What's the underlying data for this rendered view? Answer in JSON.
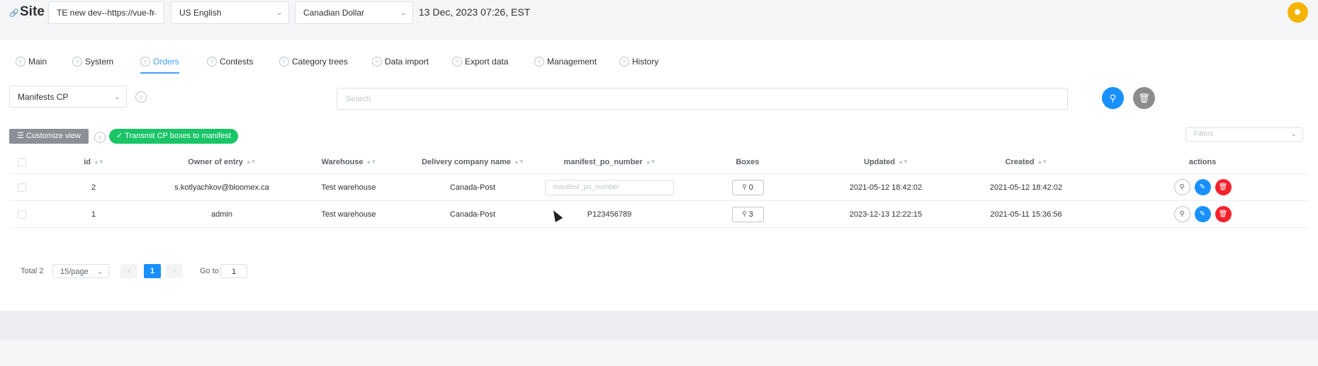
{
  "site": {
    "title": "Site",
    "site_select": "TE new dev--https://vue-fr",
    "language_select": "US English",
    "currency_select": "Canadian Dollar",
    "datetime": "13 Dec, 2023 07:26, EST"
  },
  "tabs": [
    {
      "label": "Main"
    },
    {
      "label": "System"
    },
    {
      "label": "Orders",
      "active": true
    },
    {
      "label": "Contests"
    },
    {
      "label": "Category trees"
    },
    {
      "label": "Data import"
    },
    {
      "label": "Export data"
    },
    {
      "label": "Management"
    },
    {
      "label": "History"
    }
  ],
  "toolbar": {
    "manifest_select": "Manifests CP",
    "search_placeholder": "Search",
    "customize_label": "Customize view",
    "transmit_label": "Transmit CP boxes to manifest",
    "filters_placeholder": "Filters"
  },
  "table": {
    "columns": [
      "id",
      "Owner of entry",
      "Warehouse",
      "Delivery company name",
      "manifest_po_number",
      "Boxes",
      "Updated",
      "Created",
      "actions"
    ],
    "manifest_placeholder": "manifest_po_number",
    "rows": [
      {
        "id": "2",
        "owner": "s.kotlyachkov@bloomex.ca",
        "warehouse": "Test warehouse",
        "delivery": "Canada-Post",
        "manifest_po_number": "",
        "boxes": "0",
        "updated": "2021-05-12 18:42:02",
        "created": "2021-05-12 18:42:02"
      },
      {
        "id": "1",
        "owner": "admin",
        "warehouse": "Test warehouse",
        "delivery": "Canada-Post",
        "manifest_po_number": "P123456789",
        "boxes": "3",
        "updated": "2023-12-13 12:22:15",
        "created": "2021-05-11 15:36:56"
      }
    ]
  },
  "pagination": {
    "total": "Total 2",
    "page_size": "15/page",
    "current_page": "1",
    "goto_label": "Go to",
    "goto_value": "1"
  },
  "colors": {
    "primary": "#1890ff",
    "success": "#19c567",
    "danger": "#f5222d",
    "neutral": "#8c8f96",
    "avatar": "#f5b400"
  }
}
